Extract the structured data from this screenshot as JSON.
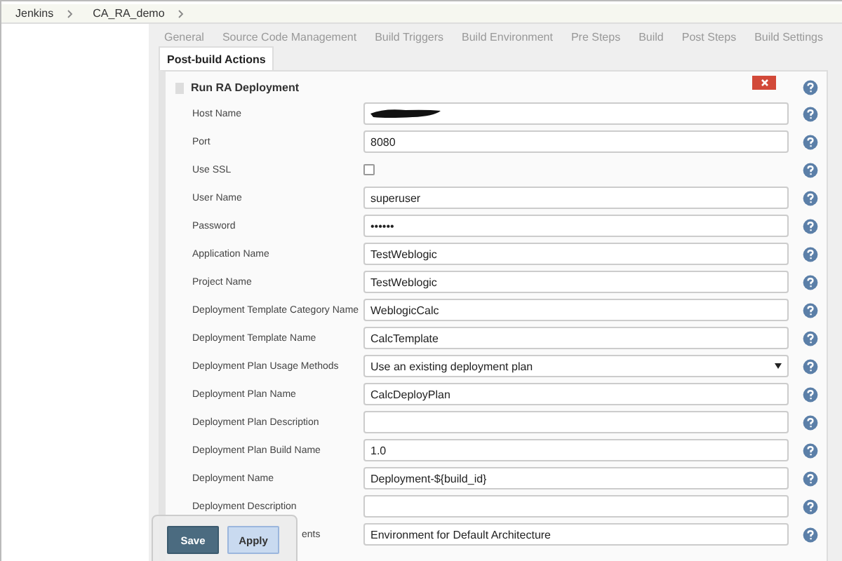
{
  "breadcrumb": [
    "Jenkins",
    "CA_RA_demo"
  ],
  "tabs": [
    {
      "label": "General",
      "selected": false
    },
    {
      "label": "Source Code Management",
      "selected": false
    },
    {
      "label": "Build Triggers",
      "selected": false
    },
    {
      "label": "Build Environment",
      "selected": false
    },
    {
      "label": "Pre Steps",
      "selected": false
    },
    {
      "label": "Build",
      "selected": false
    },
    {
      "label": "Post Steps",
      "selected": false
    },
    {
      "label": "Build Settings",
      "selected": false
    },
    {
      "label": "Post-build Actions",
      "selected": true
    }
  ],
  "section": {
    "title": "Run RA Deployment",
    "fields": [
      {
        "kind": "text",
        "label": "Host Name",
        "redacted": true
      },
      {
        "kind": "text",
        "label": "Port",
        "value": "8080"
      },
      {
        "kind": "checkbox",
        "label": "Use SSL",
        "checked": false
      },
      {
        "kind": "text",
        "label": "User Name",
        "value": "superuser"
      },
      {
        "kind": "password",
        "label": "Password",
        "value": "••••••"
      },
      {
        "kind": "text",
        "label": "Application Name",
        "value": "TestWeblogic"
      },
      {
        "kind": "text",
        "label": "Project Name",
        "value": "TestWeblogic"
      },
      {
        "kind": "text",
        "label": "Deployment Template Category Name",
        "value": "WeblogicCalc"
      },
      {
        "kind": "text",
        "label": "Deployment Template Name",
        "value": "CalcTemplate"
      },
      {
        "kind": "select",
        "label": "Deployment Plan Usage Methods",
        "value": "Use an existing deployment plan"
      },
      {
        "kind": "text",
        "label": "Deployment Plan Name",
        "value": "CalcDeployPlan"
      },
      {
        "kind": "text",
        "label": "Deployment Plan Description"
      },
      {
        "kind": "text",
        "label": "Deployment Plan Build Name",
        "value": "1.0"
      },
      {
        "kind": "text",
        "label": "Deployment Name",
        "value": "Deployment-${build_id}"
      },
      {
        "kind": "text",
        "label": "Deployment Description"
      },
      {
        "kind": "text",
        "label": "ents",
        "covered": true,
        "value": "Environment for Default Architecture"
      }
    ]
  },
  "buttons": [
    {
      "kind": "primary",
      "label": "Save"
    },
    {
      "kind": "secondary",
      "label": "Apply"
    }
  ]
}
